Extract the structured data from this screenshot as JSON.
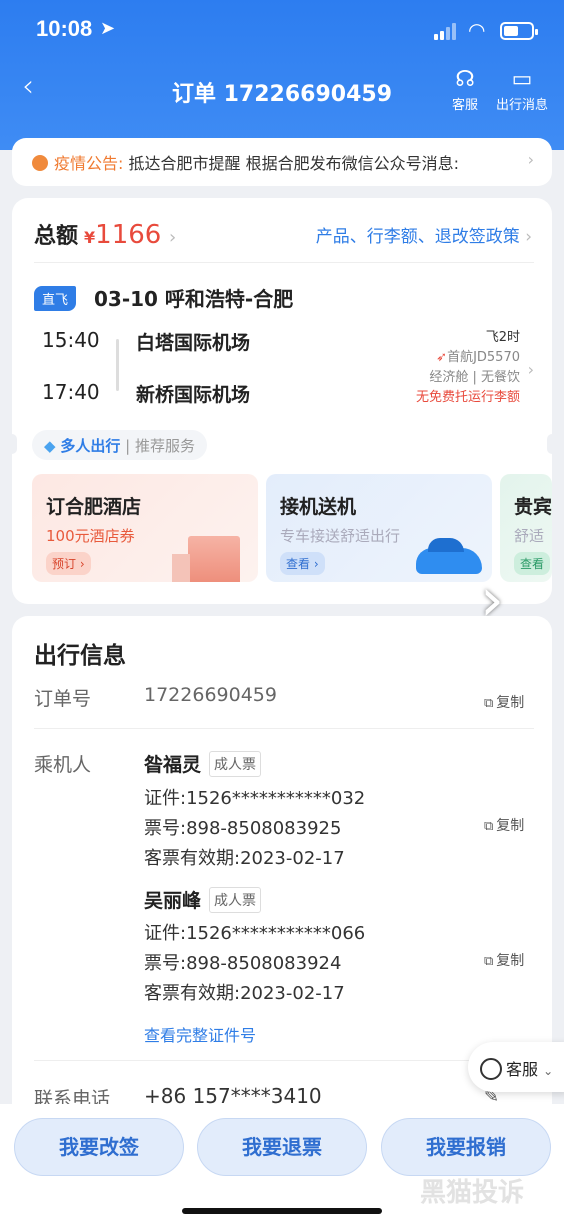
{
  "status": {
    "time": "10:08",
    "location_icon": "location-arrow-icon"
  },
  "nav": {
    "title": "订单 17226690459",
    "service_label": "客服",
    "messages_label": "出行消息"
  },
  "notice": {
    "label": "疫情公告:",
    "text": " 抵达合肥市提醒 根据合肥发布微信公众号消息:"
  },
  "total": {
    "label": "总额",
    "currency": "¥",
    "amount": "1166",
    "policy_link": "产品、行李额、退改签政策"
  },
  "flight": {
    "tag": "直飞",
    "route": "03-10 呼和浩特-合肥",
    "depart_time": "15:40",
    "depart_airport": "白塔国际机场",
    "arrive_time": "17:40",
    "arrive_airport": "新桥国际机场",
    "duration": "飞2时",
    "flight_no": "首航JD5570",
    "cabin": "经济舱 | 无餐饮",
    "baggage": "无免费托运行李额"
  },
  "multi": {
    "label": "多人出行",
    "sub": "推荐服务"
  },
  "services": [
    {
      "title": "订合肥酒店",
      "subtitle": "100元酒店券",
      "button": "预订 ›"
    },
    {
      "title": "接机送机",
      "subtitle": "专车接送舒适出行",
      "button": "查看 ›"
    },
    {
      "title": "贵宾",
      "subtitle": "舒适",
      "button": "查看"
    }
  ],
  "info": {
    "title": "出行信息",
    "order_label": "订单号",
    "order_no": "17226690459",
    "copy_label": "复制",
    "passenger_label": "乘机人",
    "passengers": [
      {
        "name": "昝福灵",
        "type": "成人票",
        "id": "证件:1526***********032",
        "ticket": "票号:898-8508083925",
        "valid": "客票有效期:2023-02-17"
      },
      {
        "name": "吴丽峰",
        "type": "成人票",
        "id": "证件:1526***********066",
        "ticket": "票号:898-8508083924",
        "valid": "客票有效期:2023-02-17"
      }
    ],
    "view_full_id": "查看完整证件号",
    "phone_label": "联系电话",
    "phone": "+86 157****3410"
  },
  "floating_service": "客服",
  "actions": {
    "change": "我要改签",
    "refund": "我要退票",
    "reimburse": "我要报销"
  },
  "watermark": "黑猫投诉",
  "colors": {
    "primary": "#2f7de6",
    "price": "#e84a3c",
    "notice": "#f07a30"
  }
}
